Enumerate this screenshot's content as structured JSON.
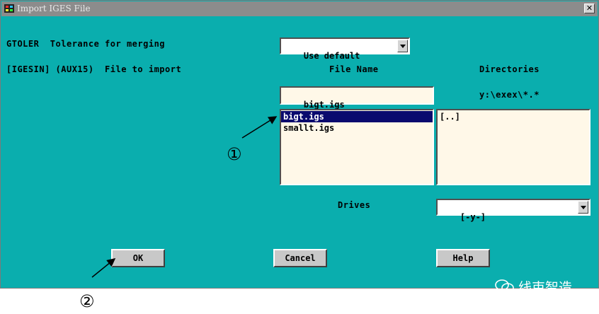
{
  "window": {
    "title": "Import IGES File",
    "close_glyph": "✕"
  },
  "tolerance": {
    "label": "GTOLER  Tolerance for merging",
    "value": "Use default"
  },
  "import": {
    "label": "[IGESIN] (AUX15)  File to import",
    "file_name_header": "File Name",
    "directories_header": "Directories",
    "file_name_value": "bigt.igs",
    "current_path": "y:\\exex\\*.*",
    "files": [
      "bigt.igs",
      "smallt.igs"
    ],
    "selected_file_index": 0,
    "directories": [
      "[..]"
    ],
    "drives_label": "Drives",
    "drive_value": "[-y-]"
  },
  "buttons": {
    "ok": "OK",
    "cancel": "Cancel",
    "help": "Help"
  },
  "annotations": {
    "callout_1": "①",
    "callout_2": "②"
  },
  "watermark": {
    "text": "线束智造"
  }
}
